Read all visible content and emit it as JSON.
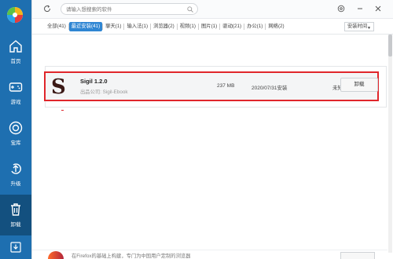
{
  "sidebar": {
    "items": [
      {
        "label": "首页",
        "icon": "home-icon"
      },
      {
        "label": "游戏",
        "icon": "gamepad-icon"
      },
      {
        "label": "宝库",
        "icon": "treasure-icon"
      },
      {
        "label": "升级",
        "icon": "upgrade-icon"
      },
      {
        "label": "卸载",
        "icon": "trash-icon"
      }
    ],
    "active_color": "#13507f",
    "bg_color": "#1e6fb0"
  },
  "topbar": {
    "search_placeholder": "请输入想搜索的软件"
  },
  "tabs": [
    {
      "label": "全部(41)",
      "active": false
    },
    {
      "label": "最近安装(41)",
      "active": true
    },
    {
      "label": "聊天(1)",
      "active": false
    },
    {
      "label": "输入法(1)",
      "active": false
    },
    {
      "label": "浏览器(2)",
      "active": false
    },
    {
      "label": "视频(1)",
      "active": false
    },
    {
      "label": "图片(1)",
      "active": false
    },
    {
      "label": "驱动(21)",
      "active": false
    },
    {
      "label": "办公(1)",
      "active": false
    },
    {
      "label": "网络(2)",
      "active": false
    }
  ],
  "sort": {
    "value": "安装时间"
  },
  "app": {
    "icon_letter": "S",
    "name": "Sigil 1.2.0",
    "publisher": "出品公司: Sigil-Ebook",
    "size": "237 MB",
    "install_date": "2020/07/31安装",
    "status": "未知",
    "uninstall_label": "卸载"
  },
  "bottom_peek": {
    "text": "在Firefox的基础上构建，专门为中国用户定制的浏览器"
  },
  "colors": {
    "accent": "#2f86d3",
    "highlight_border": "#e0262b"
  }
}
